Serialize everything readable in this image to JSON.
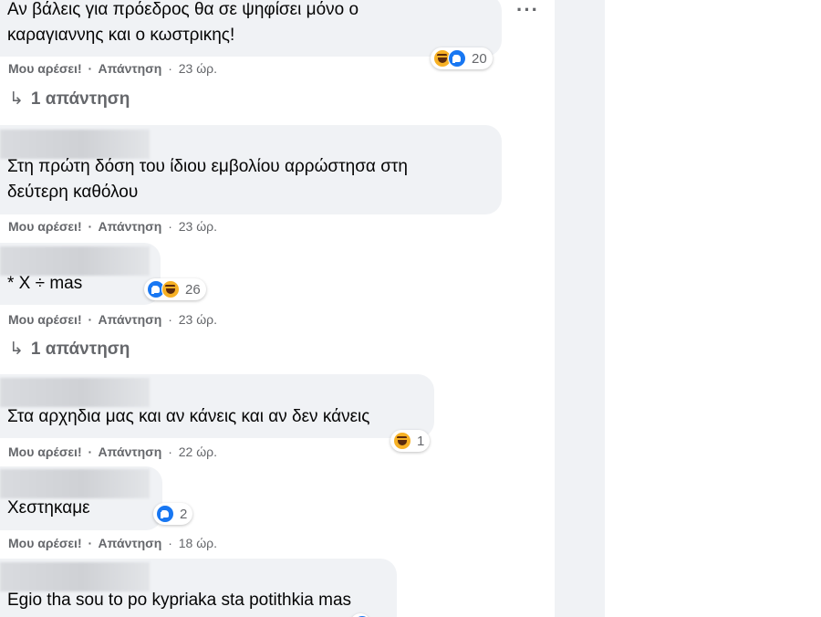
{
  "comments": [
    {
      "text_line1": "Αν βάλεις για πρόεδρος θα σε ψηφίσει μόνο ο",
      "text_line2": "καραγιαννης και ο κωστρικης!",
      "like": "Μου αρέσει!",
      "reply": "Απάντηση",
      "time": "23 ώρ.",
      "reactions": [
        "haha-icon",
        "like-icon"
      ],
      "reaction_count": "20",
      "replies": "1 απάντηση"
    },
    {
      "text_line1": "Στη πρώτη δόση του ίδιου εμβολίου αρρώστησα στη",
      "text_line2": "δεύτερη καθόλου",
      "like": "Μου αρέσει!",
      "reply": "Απάντηση",
      "time": "23 ώρ."
    },
    {
      "text_line1": "* X ÷ mas",
      "like": "Μου αρέσει!",
      "reply": "Απάντηση",
      "time": "23 ώρ.",
      "reactions": [
        "like-icon",
        "haha-icon"
      ],
      "reaction_count": "26",
      "replies": "1 απάντηση"
    },
    {
      "text_line1": "Στα αρχηδια μας και αν κάνεις και αν δεν κάνεις",
      "like": "Μου αρέσει!",
      "reply": "Απάντηση",
      "time": "22 ώρ.",
      "reactions": [
        "haha-icon"
      ],
      "reaction_count": "1"
    },
    {
      "text_line1": "Χεστηκαμε",
      "like": "Μου αρέσει!",
      "reply": "Απάντηση",
      "time": "18 ώρ.",
      "reactions": [
        "like-icon"
      ],
      "reaction_count": "2"
    },
    {
      "text_line1": "Egio tha sou to po kypriaka sta potithkia mas"
    }
  ],
  "separator": "·",
  "more_icon": "more-options-icon",
  "colors": {
    "bubble": "#f0f2f5",
    "meta_text": "#65676b",
    "like_blue": "#1877f2",
    "haha_yellow": "#f7b125"
  }
}
